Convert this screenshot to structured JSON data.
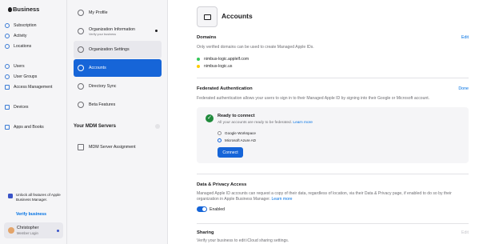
{
  "sidebar": {
    "brand": "Business",
    "items": [
      {
        "label": "Subscription",
        "icon": "dollar-circle-icon"
      },
      {
        "label": "Activity",
        "icon": "activity-icon"
      },
      {
        "label": "Locations",
        "icon": "location-pin-icon"
      },
      {
        "label": "Users",
        "icon": "user-icon"
      },
      {
        "label": "User Groups",
        "icon": "user-group-icon"
      },
      {
        "label": "Access Management",
        "icon": "lock-icon"
      },
      {
        "label": "Devices",
        "icon": "laptop-icon"
      },
      {
        "label": "Apps and Books",
        "icon": "apps-icon"
      }
    ],
    "promo": {
      "text": "Unlock all features of Apple Business Manager.",
      "link": "Verify business"
    },
    "user": {
      "name": "Christopher",
      "role": "Member Login"
    }
  },
  "subnav": {
    "items": [
      {
        "label": "My Profile",
        "icon": "user-circle-icon"
      },
      {
        "label": "Organization Information",
        "sub": "Verify your business",
        "icon": "info-icon"
      },
      {
        "label": "Organization Settings",
        "icon": "gear-icon"
      },
      {
        "label": "Accounts",
        "icon": "at-icon"
      },
      {
        "label": "Directory Sync",
        "icon": "sync-icon"
      },
      {
        "label": "Beta Features",
        "icon": "beta-icon"
      }
    ],
    "mdm_title": "Your MDM Servers",
    "mdm_items": [
      {
        "label": "MDM Server Assignment",
        "icon": "server-icon"
      }
    ]
  },
  "main": {
    "title": "Accounts",
    "domains": {
      "title": "Domains",
      "action": "Edit",
      "desc": "Only verified domains can be used to create Managed Apple IDs.",
      "list": [
        {
          "name": "nimbus-logic.applelf.com",
          "status_color": "#34c759"
        },
        {
          "name": "nimbus-logic.us",
          "status_color": "#ffcc00"
        }
      ]
    },
    "federated": {
      "title": "Federated Authentication",
      "action": "Done",
      "desc": "Federated authentication allows your users to sign in to their Managed Apple ID by signing into their Google or Microsoft account.",
      "ready_title": "Ready to connect",
      "ready_sub": "All your accounts are ready to be federated.",
      "learn_more": "Learn more",
      "options": [
        {
          "label": "Google Workspace",
          "selected": false
        },
        {
          "label": "Microsoft Azure AD",
          "selected": true
        }
      ],
      "connect_label": "Connect"
    },
    "privacy": {
      "title": "Data & Privacy Access",
      "desc1": "Managed Apple ID accounts can request a copy of their data, regardless of location, via their Data & Privacy page, if enabled to do so by their",
      "desc2": "organization in Apple Business Manager.",
      "learn_more": "Learn more",
      "toggle_label": "Enabled",
      "enabled": true
    },
    "sharing": {
      "title": "Sharing",
      "action": "Edit",
      "desc": "Verify your business to edit iCloud sharing settings."
    }
  }
}
